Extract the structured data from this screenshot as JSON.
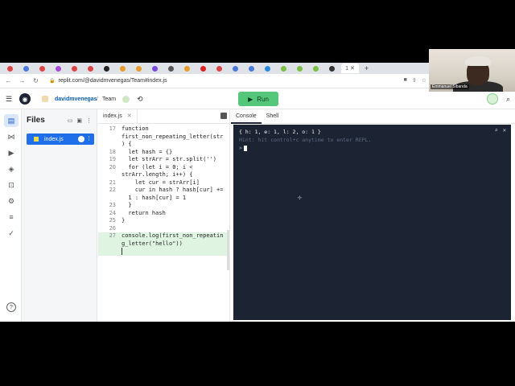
{
  "webcam": {
    "name": "Emmanuel Sibanda"
  },
  "browser": {
    "tabs": [
      "M",
      "C",
      "M",
      "O",
      "M",
      "M",
      "",
      "",
      "",
      "",
      "",
      "",
      "",
      "",
      "",
      "",
      "",
      "",
      "",
      "",
      ""
    ],
    "active_tab_label": "1",
    "url": "replit.com/@davidmvenegas/Team#index.js"
  },
  "header": {
    "user": "davidmvenegas",
    "separator": "/",
    "team": "Team",
    "run_label": "Run"
  },
  "files": {
    "title": "Files",
    "items": [
      {
        "name": "index.js"
      }
    ]
  },
  "editor": {
    "tab_label": "index.js",
    "lines": [
      {
        "n": "17",
        "text": "function"
      },
      {
        "n": "",
        "text": "first_non_repeating_letter(str"
      },
      {
        "n": "",
        "text": ") {"
      },
      {
        "n": "18",
        "text": "  let hash = {}"
      },
      {
        "n": "19",
        "text": "  let strArr = str.split('')"
      },
      {
        "n": "20",
        "text": "  for (let i = 0; i <"
      },
      {
        "n": "",
        "text": "strArr.length; i++) {"
      },
      {
        "n": "21",
        "text": "    let cur = strArr[i]"
      },
      {
        "n": "22",
        "text": "    cur in hash ? hash[cur] +="
      },
      {
        "n": "",
        "text": "  1 : hash[cur] = 1"
      },
      {
        "n": "23",
        "text": "  }"
      },
      {
        "n": "24",
        "text": "  return hash"
      },
      {
        "n": "25",
        "text": "}"
      },
      {
        "n": "26",
        "text": ""
      },
      {
        "n": "27",
        "text": "console.log(first_non_repeatin"
      },
      {
        "n": "",
        "text": "g_letter(\"hello\"))"
      }
    ]
  },
  "console": {
    "tabs": [
      "Console",
      "Shell"
    ],
    "output": "{ h: 1, e: 1, l: 2, o: 1 }",
    "hint": "Hint: hit control+c anytime to enter REPL.",
    "prompt": ">"
  }
}
